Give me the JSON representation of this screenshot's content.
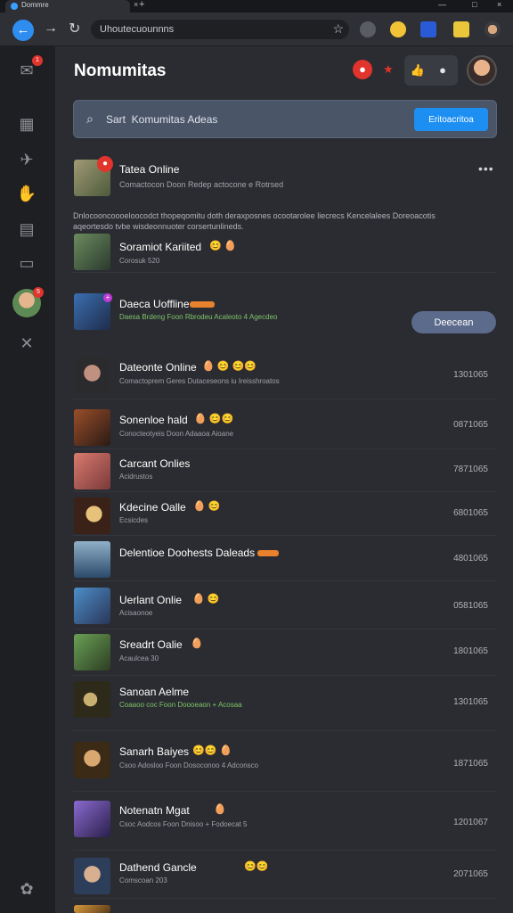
{
  "browser": {
    "tab_title": "Dommre",
    "url": "Uhoutecuounnns",
    "tab_close_glyph": "×",
    "tab_new_glyph": "+",
    "window_controls": [
      "—",
      "□",
      "×"
    ]
  },
  "rail": {
    "badge_top": "1",
    "badge_avatar": "5",
    "items": [
      "inbox-icon",
      "calendar-icon",
      "pin-icon",
      "hand-icon",
      "chart-icon",
      "folder-icon",
      "close-icon",
      "settings-icon"
    ]
  },
  "header": {
    "title": "Nomumitas"
  },
  "search": {
    "placeholder": "Sart  Komumitas Adeas",
    "button_label": "Eritoacritoa"
  },
  "featured": {
    "name": "Tatea Online",
    "subtitle": "Comactocon Doon Redep actocone e Rotrsed",
    "description": "Dnlocooncoooeloocodct thopeqomitu doth deraxposnes ocootarolee liecrecs Kencelalees Doreoacotis aqeortesdo tvbe wisdeonnuoter corsertunlineds.",
    "accent": "#e0342c"
  },
  "rows": [
    {
      "name": "Soramiot Kariited",
      "subtitle": "Corosuk 520",
      "emojis": "😊 🥚",
      "count": "",
      "action": ""
    },
    {
      "name": "Daeca Uoffline",
      "subtitle": "Daesa Brdeng  Foon Rbrodeu Acaleoto 4 Agecdeo",
      "emojis": "",
      "count": "",
      "action": "Deecean"
    },
    {
      "name": "Dateonte Online",
      "subtitle": "Comactoprem Geres Dutaceseons iu Ireisshroatos",
      "emojis": "🥚     😊       😊😊",
      "count": "1301065",
      "action": ""
    },
    {
      "name": "Sonenloe hald",
      "subtitle": "Conocteotyeis Doon Adaaoa Aioane",
      "emojis": "🥚     😊😊",
      "count": "0871065",
      "action": ""
    },
    {
      "name": "Carcant Onlies",
      "subtitle": "Acidrustos",
      "emojis": "",
      "count": "7871065",
      "action": ""
    },
    {
      "name": "Kdecine Oalle",
      "subtitle": "Ecsicdes",
      "emojis": "🥚      😊",
      "count": "6801065",
      "action": ""
    },
    {
      "name": "Delentioe Doohests Daleads",
      "subtitle": "",
      "emojis": "",
      "count": "4801065",
      "action": ""
    },
    {
      "name": "Uerlant Onlie",
      "subtitle": "Acisaonoe",
      "emojis": "🥚      😊",
      "count": "0581065",
      "action": ""
    },
    {
      "name": "Sreadrt Oalie",
      "subtitle": "Acaulcea 30",
      "emojis": "🥚",
      "count": "1801065",
      "action": ""
    },
    {
      "name": "Sanoan Aelme",
      "subtitle": "Coaaoo coc  Foon Doooeaon + Acosaa",
      "emojis": "",
      "count": "1301065",
      "action": ""
    },
    {
      "name": "Sanarh Baiyes",
      "subtitle": "Csoo Adosloo Foon Dosoconoo 4 Adconsco",
      "emojis": "😊😊    🥚",
      "count": "1871065",
      "action": ""
    },
    {
      "name": "Notenatn Mgat",
      "subtitle": "Csoc Aodcos  Foon Dnisoo + Fodoecat 5",
      "emojis": "🥚",
      "count": "1201067",
      "action": ""
    },
    {
      "name": "Dathend Gancle",
      "subtitle": "Comscoan 203",
      "emojis": "😊😊",
      "count": "2071065",
      "action": ""
    }
  ],
  "colors": {
    "accent_blue": "#1d8ff2",
    "badge_red": "#e0342c",
    "action_pill": "#5c6a8c"
  }
}
